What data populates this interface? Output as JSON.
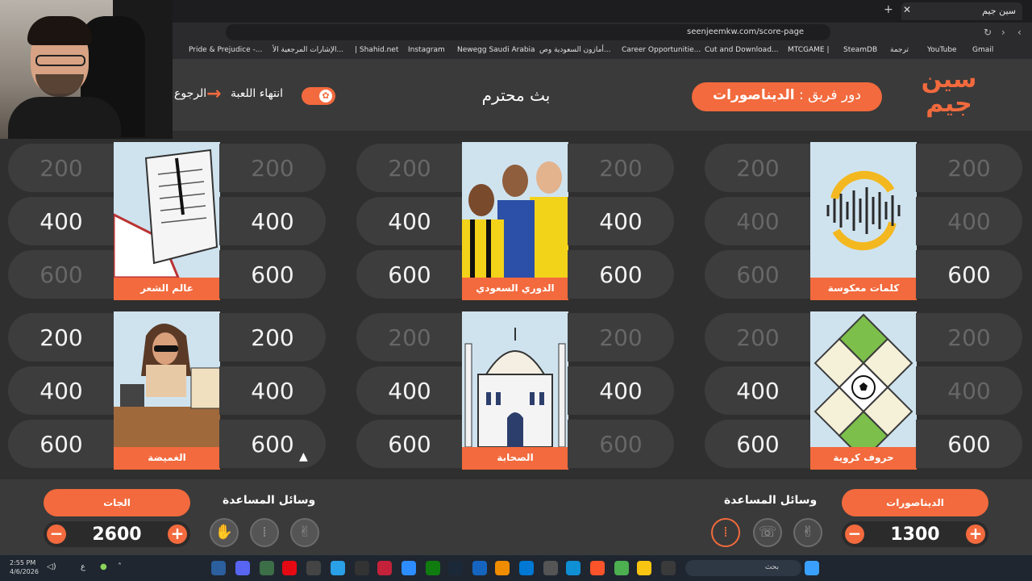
{
  "browser": {
    "tab_title": "سين جيم",
    "url": "seenjeemkw.com/score-page",
    "bookmarks": [
      "Gmail",
      "YouTube",
      "ترجمة",
      "SteamDB",
      "MTCGAME |",
      "Cut and Download...",
      "Career Opportunitie...",
      "أمازون السعودية وص...",
      "Newegg Saudi Arabia",
      "Instagram",
      "| Shahid.net",
      "الإشارات المرجعية الأ...",
      "Pride & Prejudice -..."
    ]
  },
  "header": {
    "logo_text": "سين جيم",
    "turn_prefix": "دور فريق :",
    "turn_team": "الديناصورات",
    "game_title": "بث محترم",
    "end_game_label": "انتهاء اللعبة",
    "back_label": "الرجوع"
  },
  "board": {
    "categories": [
      {
        "name": "كلمات معكوسة",
        "left": [
          {
            "v": "200",
            "used": true
          },
          {
            "v": "400",
            "used": true
          },
          {
            "v": "600",
            "used": true
          }
        ],
        "right": [
          {
            "v": "200",
            "used": true
          },
          {
            "v": "400",
            "used": true
          },
          {
            "v": "600",
            "used": false
          }
        ]
      },
      {
        "name": "الدوري السعودي",
        "left": [
          {
            "v": "200",
            "used": true
          },
          {
            "v": "400",
            "used": false
          },
          {
            "v": "600",
            "used": false
          }
        ],
        "right": [
          {
            "v": "200",
            "used": true
          },
          {
            "v": "400",
            "used": false
          },
          {
            "v": "600",
            "used": false
          }
        ]
      },
      {
        "name": "عالم الشعر",
        "left": [
          {
            "v": "200",
            "used": true
          },
          {
            "v": "400",
            "used": false
          },
          {
            "v": "600",
            "used": true
          }
        ],
        "right": [
          {
            "v": "200",
            "used": true
          },
          {
            "v": "400",
            "used": false
          },
          {
            "v": "600",
            "used": false
          }
        ]
      },
      {
        "name": "حروف كروية",
        "left": [
          {
            "v": "200",
            "used": true
          },
          {
            "v": "400",
            "used": false
          },
          {
            "v": "600",
            "used": false
          }
        ],
        "right": [
          {
            "v": "200",
            "used": true
          },
          {
            "v": "400",
            "used": true
          },
          {
            "v": "600",
            "used": false
          }
        ]
      },
      {
        "name": "الصحابة",
        "left": [
          {
            "v": "200",
            "used": true
          },
          {
            "v": "400",
            "used": false
          },
          {
            "v": "600",
            "used": false
          }
        ],
        "right": [
          {
            "v": "200",
            "used": true
          },
          {
            "v": "400",
            "used": false
          },
          {
            "v": "600",
            "used": true
          }
        ]
      },
      {
        "name": "الغميضة",
        "left": [
          {
            "v": "200",
            "used": false
          },
          {
            "v": "400",
            "used": false
          },
          {
            "v": "600",
            "used": false
          }
        ],
        "right": [
          {
            "v": "200",
            "used": false
          },
          {
            "v": "400",
            "used": false
          },
          {
            "v": "600",
            "used": false
          }
        ]
      }
    ]
  },
  "teams": {
    "team_a": {
      "name": "الديناصورات",
      "score": "1300",
      "help_title": "وسائل المساعدة"
    },
    "team_b": {
      "name": "الجات",
      "score": "2600",
      "help_title": "وسائل المساعدة"
    }
  },
  "taskbar": {
    "time": "2:55 PM",
    "date": "4/6/2026",
    "search_placeholder": "بحث",
    "lang": "ع"
  },
  "colors": {
    "accent": "#f26a3d",
    "background": "#2f2f2f",
    "tile": "#3d3d3d"
  }
}
